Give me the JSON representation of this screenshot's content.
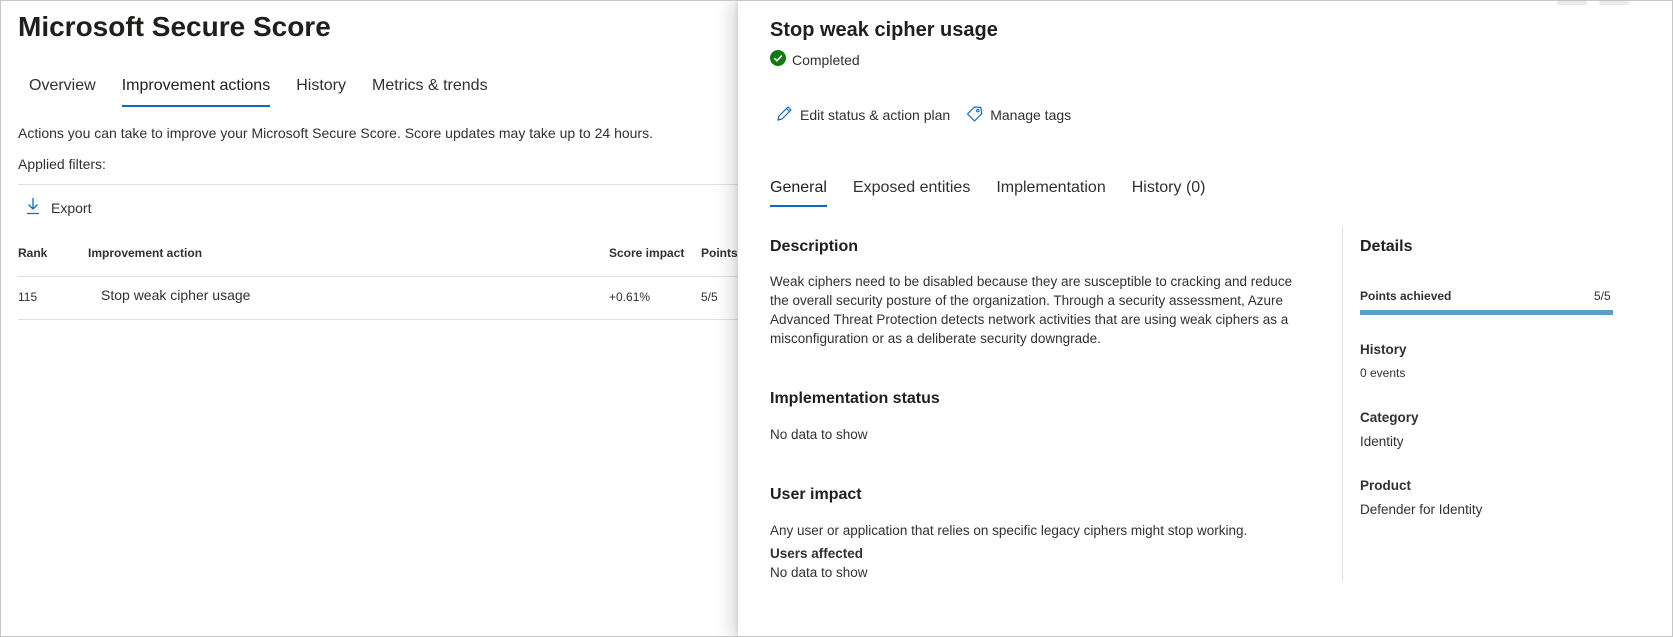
{
  "page": {
    "title": "Microsoft Secure Score",
    "tabs": [
      "Overview",
      "Improvement actions",
      "History",
      "Metrics & trends"
    ],
    "intro": "Actions you can take to improve your Microsoft Secure Score. Score updates may take up to 24 hours.",
    "filters_label": "Applied filters:",
    "export_label": "Export",
    "table": {
      "headers": [
        "Rank",
        "Improvement action",
        "Score impact",
        "Points"
      ],
      "row": {
        "rank": "115",
        "action": "Stop weak cipher usage",
        "impact": "+0.61%",
        "points": "5/5"
      }
    }
  },
  "panel": {
    "title": "Stop weak cipher usage",
    "status": "Completed",
    "status_color": "#107c10",
    "edit_label": "Edit status & action plan",
    "tags_label": "Manage tags",
    "tabs": [
      "General",
      "Exposed entities",
      "Implementation",
      "History (0)"
    ],
    "description_heading": "Description",
    "description": "Weak ciphers need to be disabled because they are susceptible to cracking and reduce the overall security posture of the organization. Through a security assessment, Azure Advanced Threat Protection detects network activities that are using weak ciphers as a misconfiguration or as a deliberate security downgrade.",
    "impl_heading": "Implementation status",
    "impl_value": "No data to show",
    "user_heading": "User impact",
    "user_text": "Any user or application that relies on specific legacy ciphers might stop working.",
    "users_affected_label": "Users affected",
    "users_affected_value": "No data to show",
    "details": {
      "heading": "Details",
      "points_label": "Points achieved",
      "points_value": "5/5",
      "points_fraction": 1.0,
      "history_label": "History",
      "history_value": "0 events",
      "category_label": "Category",
      "category_value": "Identity",
      "product_label": "Product",
      "product_value": "Defender for Identity"
    },
    "accent_color": "#0f6cbd"
  }
}
